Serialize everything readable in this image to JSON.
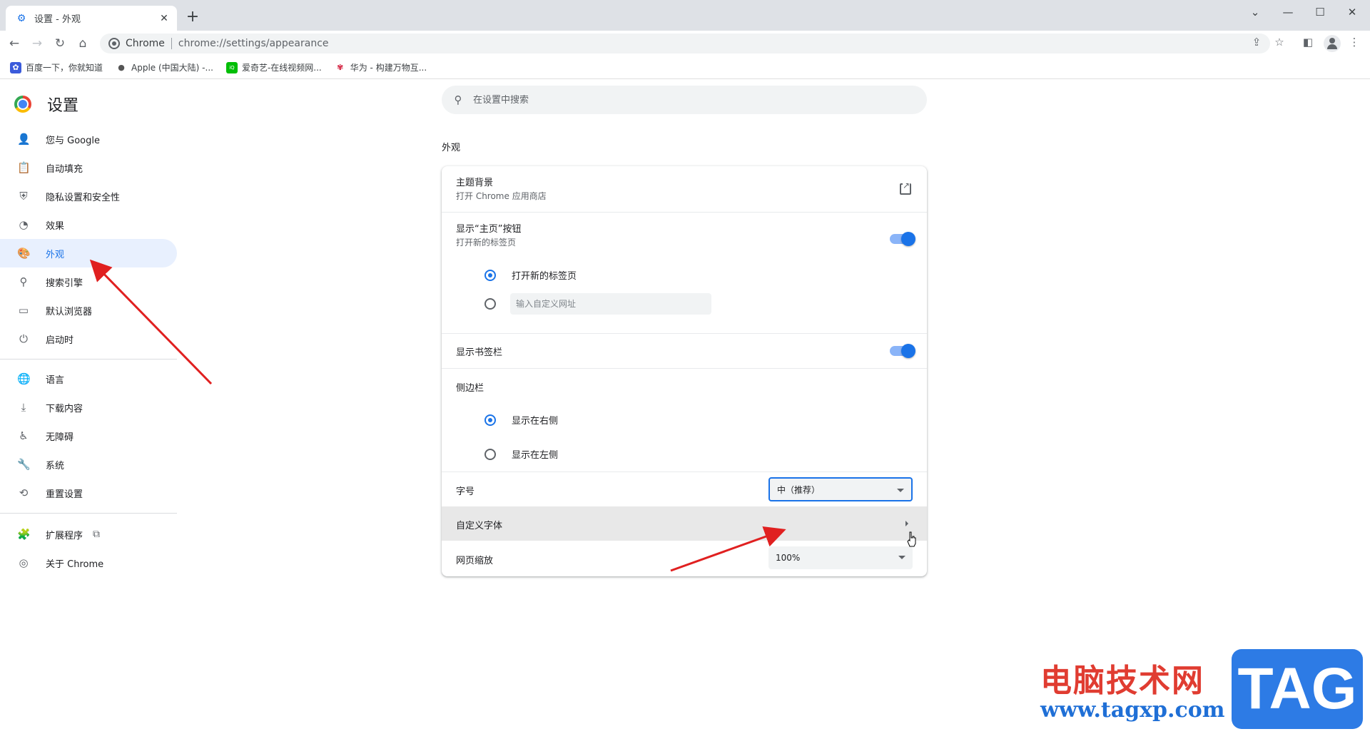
{
  "window": {
    "tab_title": "设置 - 外观",
    "tab_close": "✕",
    "new_tab": "+",
    "minimize": "—",
    "maximize": "☐",
    "close": "✕",
    "dropdown": "⌄"
  },
  "toolbar": {
    "site_name": "Chrome",
    "url": "chrome://settings/appearance"
  },
  "bookmarks": [
    {
      "label": "百度一下，你就知道",
      "icon": "baidu-icon",
      "color": "#3b5bdb"
    },
    {
      "label": "Apple (中国大陆) -...",
      "icon": "apple-icon",
      "color": "#555555"
    },
    {
      "label": "爱奇艺-在线视频网...",
      "icon": "iqiyi-icon",
      "color": "#00be06"
    },
    {
      "label": "华为 - 构建万物互...",
      "icon": "huawei-icon",
      "color": "#cf0a2c"
    }
  ],
  "sidebar": {
    "title": "设置",
    "items": [
      {
        "label": "您与 Google",
        "icon": "person-icon"
      },
      {
        "label": "自动填充",
        "icon": "clipboard-icon"
      },
      {
        "label": "隐私设置和安全性",
        "icon": "shield-icon"
      },
      {
        "label": "效果",
        "icon": "speedometer-icon"
      },
      {
        "label": "外观",
        "icon": "palette-icon",
        "active": true
      },
      {
        "label": "搜索引擎",
        "icon": "search-icon"
      },
      {
        "label": "默认浏览器",
        "icon": "browser-icon"
      },
      {
        "label": "启动时",
        "icon": "power-icon"
      },
      {
        "label": "语言",
        "icon": "globe-icon"
      },
      {
        "label": "下载内容",
        "icon": "download-icon"
      },
      {
        "label": "无障碍",
        "icon": "accessibility-icon"
      },
      {
        "label": "系统",
        "icon": "wrench-icon"
      },
      {
        "label": "重置设置",
        "icon": "history-icon"
      },
      {
        "label": "扩展程序",
        "icon": "puzzle-icon"
      },
      {
        "label": "关于 Chrome",
        "icon": "chrome-icon"
      }
    ]
  },
  "search": {
    "placeholder": "在设置中搜索"
  },
  "appearance": {
    "section_title": "外观",
    "theme": {
      "title": "主题背景",
      "subtitle": "打开 Chrome 应用商店"
    },
    "home_button": {
      "title": "显示“主页”按钮",
      "subtitle": "打开新的标签页",
      "enabled": true
    },
    "home_options": {
      "new_tab": "打开新的标签页",
      "custom_placeholder": "输入自定义网址",
      "selected": "new_tab"
    },
    "bookmarks_bar": {
      "title": "显示书签栏",
      "enabled": true
    },
    "side_panel": {
      "title": "侧边栏",
      "right": "显示在右侧",
      "left": "显示在左侧",
      "selected": "right"
    },
    "font_size": {
      "title": "字号",
      "value": "中（推荐）"
    },
    "custom_fonts": {
      "title": "自定义字体"
    },
    "page_zoom": {
      "title": "网页缩放",
      "value": "100%"
    }
  },
  "colors": {
    "accent": "#1a73e8",
    "annotation_arrow": "#e02020"
  },
  "watermark": {
    "text": "电脑技术网",
    "url": "www.tagxp.com",
    "logo": "TAG"
  }
}
